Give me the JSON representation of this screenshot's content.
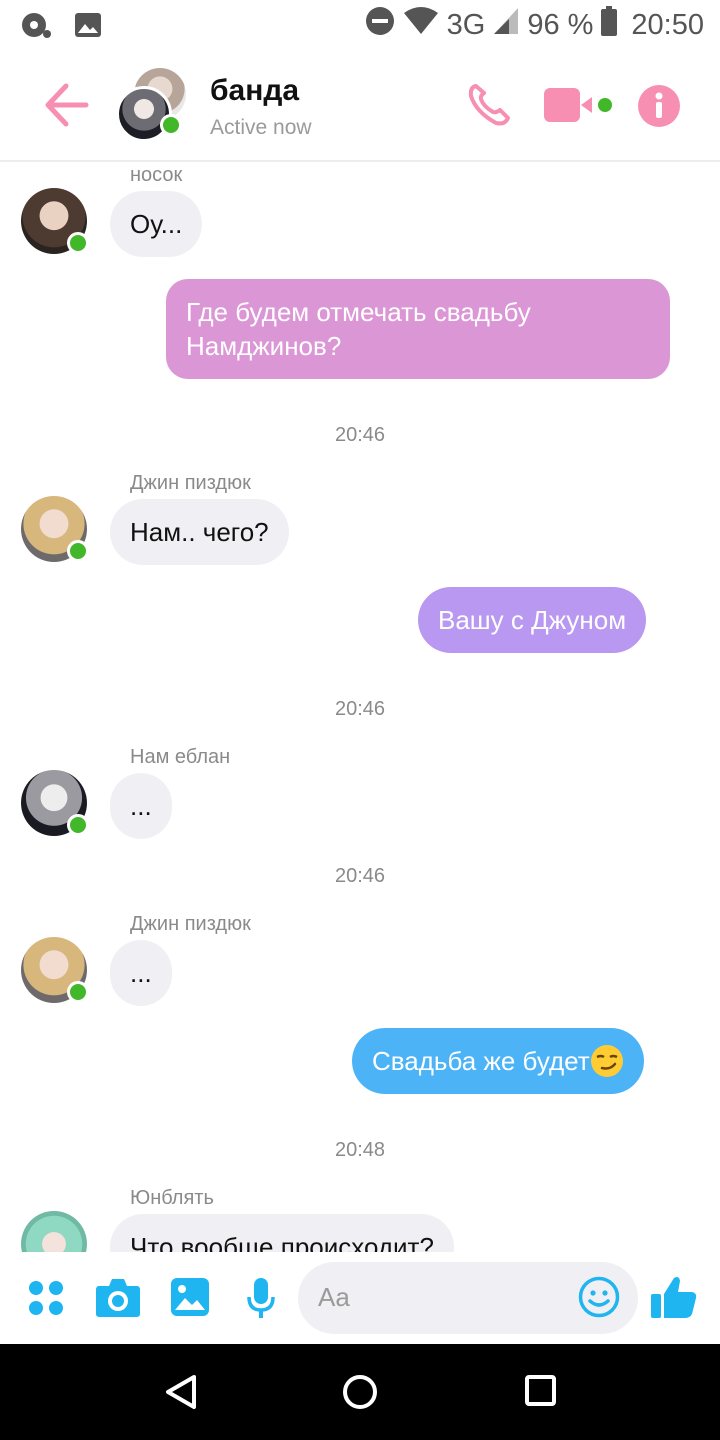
{
  "status_bar": {
    "network": "3G",
    "battery": "96 %",
    "time": "20:50"
  },
  "header": {
    "title": "банда",
    "status": "Active now",
    "accent": "#f78fb3"
  },
  "messages": [
    {
      "type": "in",
      "sender": "носок",
      "text": "Оу..."
    },
    {
      "type": "out",
      "text": "Где будем отмечать свадьбу Намджинов?",
      "color": "#db96d6"
    },
    {
      "type": "time",
      "text": "20:46"
    },
    {
      "type": "in",
      "sender": "Джин пиздюк",
      "text": "Нам.. чего?"
    },
    {
      "type": "out",
      "text": "Вашу с Джуном",
      "color": "#b898f1"
    },
    {
      "type": "time",
      "text": "20:46"
    },
    {
      "type": "in",
      "sender": "Нам еблан",
      "text": "..."
    },
    {
      "type": "time",
      "text": "20:46"
    },
    {
      "type": "in",
      "sender": "Джин пиздюк",
      "text": "..."
    },
    {
      "type": "out",
      "text": "Свадьба же будет",
      "emoji": "smirk-emoji",
      "color": "#4cb3f7"
    },
    {
      "type": "time",
      "text": "20:48"
    },
    {
      "type": "in",
      "sender": "Юнблять",
      "text": "Что вообще происходит?"
    }
  ],
  "composer": {
    "placeholder": "Aa",
    "accent": "#1eb5f0"
  },
  "icons": {
    "back": "arrow-left-icon",
    "call": "phone-icon",
    "video": "video-camera-icon",
    "info": "info-icon",
    "apps": "apps-grid-icon",
    "camera": "camera-icon",
    "gallery": "image-icon",
    "mic": "microphone-icon",
    "emoji": "smiley-icon",
    "like": "thumbs-up-icon"
  }
}
